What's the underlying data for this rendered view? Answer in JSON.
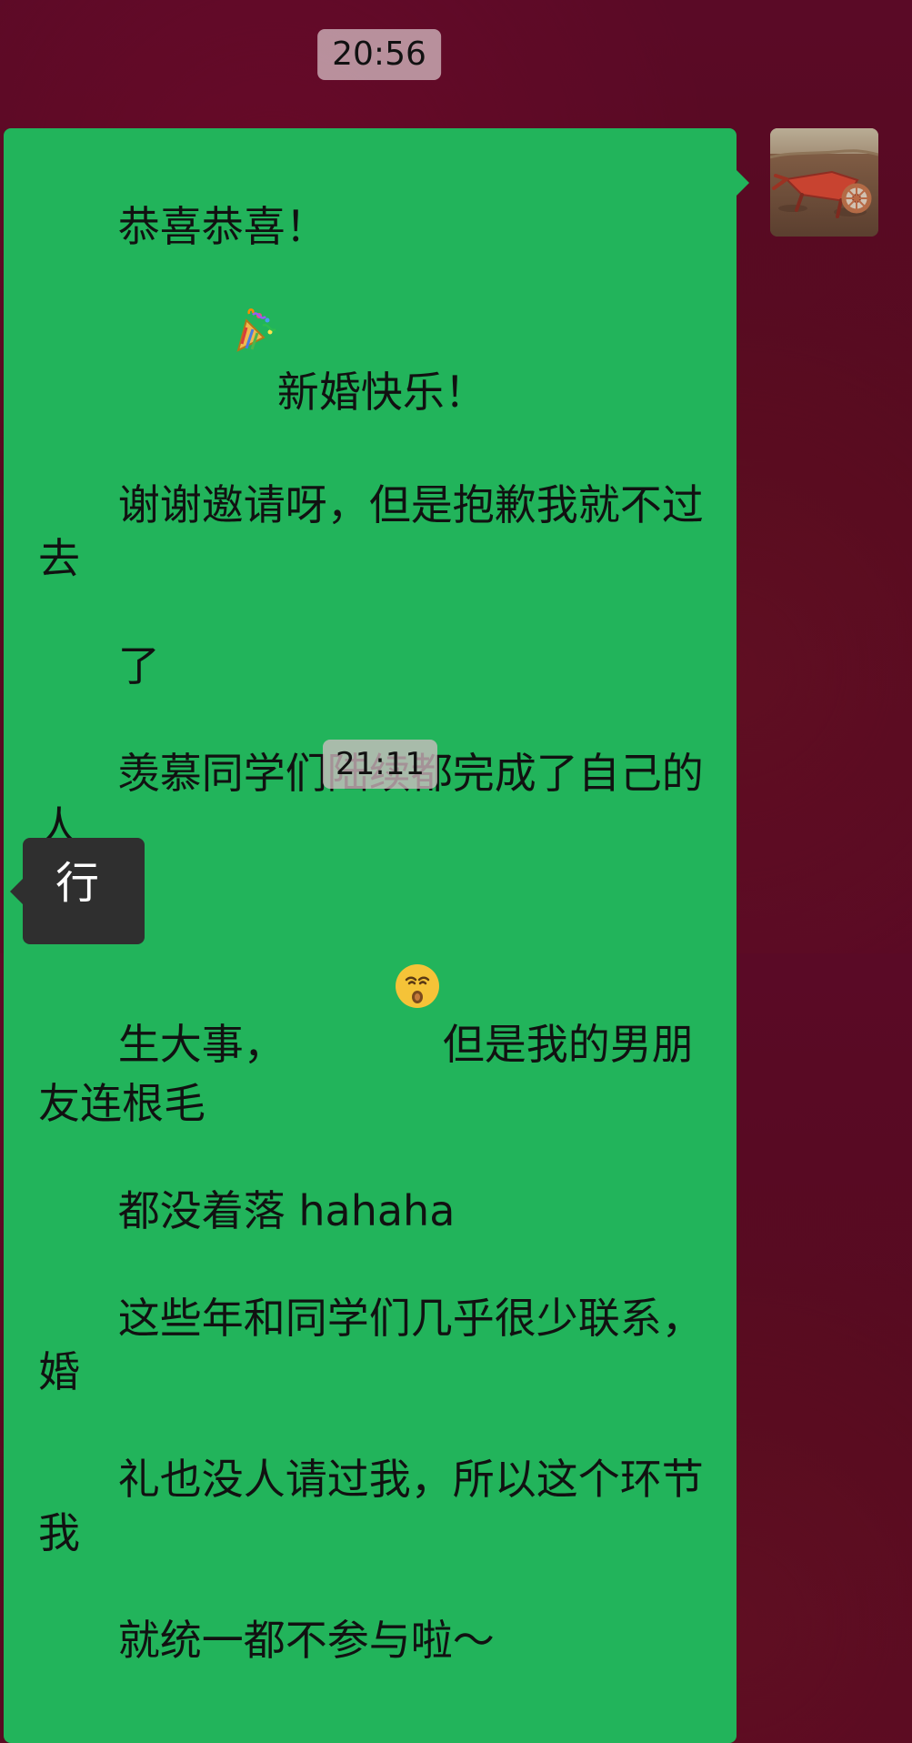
{
  "timestamps": [
    "20:56",
    "21:11"
  ],
  "message_out": {
    "lines": [
      "恭喜恭喜！",
      "新婚快乐！",
      "谢谢邀请呀，但是抱歉我就不过去",
      "了",
      "羡慕同学们陆续都完成了自己的人",
      "生大事，",
      "但是我的男朋友连根毛",
      "都没着落 hahaha",
      "这些年和同学们几乎很少联系，婚",
      "礼也没人请过我，所以这个环节我",
      "就统一都不参与啦～"
    ],
    "emojis": [
      "party-popper",
      "kissing-face"
    ]
  },
  "message_in": {
    "text": "行"
  }
}
